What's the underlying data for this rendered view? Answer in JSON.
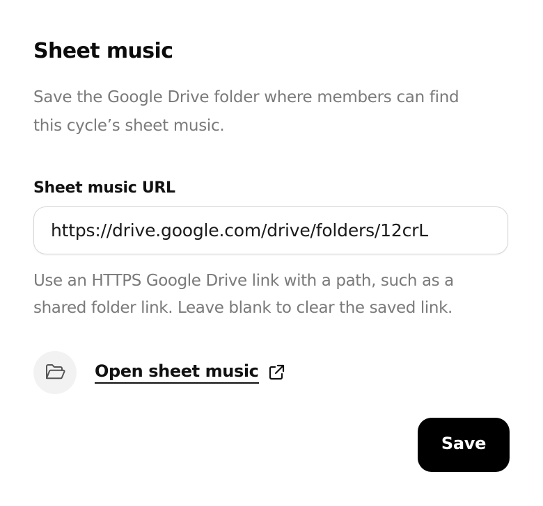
{
  "section": {
    "title": "Sheet music",
    "description": "Save the Google Drive folder where members can find this cycle’s sheet music."
  },
  "url_field": {
    "label": "Sheet music URL",
    "value": "https://drive.google.com/drive/folders/12crL",
    "hint": "Use an HTTPS Google Drive link with a path, such as a shared folder link. Leave blank to clear the saved link."
  },
  "open_link": {
    "label": "Open sheet music",
    "icon": "folder-open-icon",
    "trailing_icon": "external-link-icon"
  },
  "actions": {
    "save_label": "Save"
  },
  "colors": {
    "text_primary": "#111111",
    "text_muted": "#7a7a7a",
    "button_bg": "#000000",
    "button_text": "#ffffff",
    "input_border": "#d6d6d6",
    "icon_circle_bg": "#f2f2f2"
  }
}
